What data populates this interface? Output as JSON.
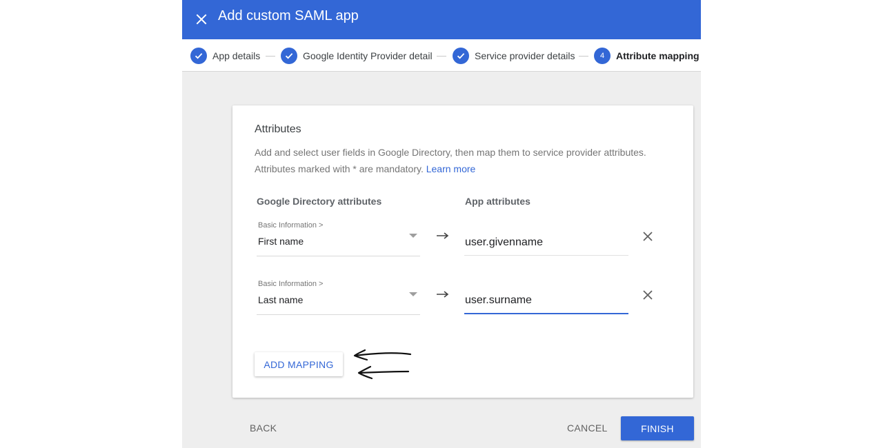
{
  "dialog": {
    "title": "Add custom SAML app",
    "close_icon": "close-icon",
    "accent_color": "#3367d6"
  },
  "steps": [
    {
      "label": "App details",
      "status": "complete"
    },
    {
      "label": "Google Identity Provider details",
      "status": "complete"
    },
    {
      "label": "Service provider details",
      "status": "complete"
    },
    {
      "label": "Attribute mapping",
      "number": "4",
      "status": "active"
    }
  ],
  "attributes": {
    "title": "Attributes",
    "description_line1": "Add and select user fields in Google Directory, then map them to service provider attributes.",
    "description_line2": "Attributes marked with * are mandatory.",
    "learn_more": "Learn more",
    "col_directory": "Google Directory attributes",
    "col_app": "App attributes",
    "mappings": [
      {
        "category": "Basic Information >",
        "field": "First name",
        "app_attribute": "user.givenname",
        "focused": false
      },
      {
        "category": "Basic Information >",
        "field": "Last name",
        "app_attribute": "user.surname",
        "focused": true
      }
    ],
    "add_mapping_label": "ADD MAPPING"
  },
  "footer": {
    "back_label": "BACK",
    "cancel_label": "CANCEL",
    "finish_label": "FINISH"
  },
  "annotation": {
    "icon": "hand-drawn-arrows-icon"
  }
}
